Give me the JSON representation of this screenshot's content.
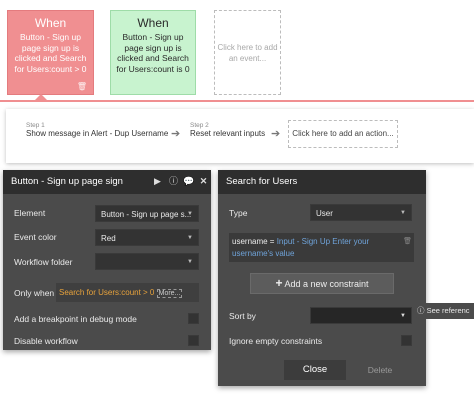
{
  "events": [
    {
      "title": "When",
      "desc": "Button - Sign up page sign up is clicked and Search for Users:count > 0"
    },
    {
      "title": "When",
      "desc": "Button - Sign up page sign up is clicked and Search for Users:count is 0"
    },
    {
      "placeholder": "Click here to add an event..."
    }
  ],
  "steps": [
    {
      "num": "Step 1",
      "label": "Show message in Alert - Dup Username"
    },
    {
      "num": "Step 2",
      "label": "Reset relevant inputs"
    }
  ],
  "add_action": "Click here to add an action...",
  "button_panel": {
    "title": "Button - Sign up page sign",
    "element_label": "Element",
    "element_value": "Button - Sign up page s...",
    "event_color_label": "Event color",
    "event_color_value": "Red",
    "workflow_folder_label": "Workflow folder",
    "only_when_label": "Only when",
    "only_when_value": "Search for Users:count > 0",
    "more_label": "More...",
    "breakpoint_label": "Add a breakpoint in debug mode",
    "disable_label": "Disable workflow"
  },
  "search_panel": {
    "title": "Search for Users",
    "type_label": "Type",
    "type_value": "User",
    "constraint_field": "username =",
    "constraint_value": "Input - Sign Up Enter your username's value",
    "add_constraint": "Add a new constraint",
    "sort_by_label": "Sort by",
    "ignore_label": "Ignore empty constraints",
    "close_label": "Close",
    "delete_label": "Delete"
  },
  "see_reference": "See referenc",
  "colors": {
    "red_event": "#f08f91",
    "green_event": "#c8f3cf",
    "panel_bg": "#4b4b4b",
    "panel_header": "#2e2e2e",
    "dynamic_text": "#e8a33c",
    "link_blue": "#6fa3d9"
  }
}
